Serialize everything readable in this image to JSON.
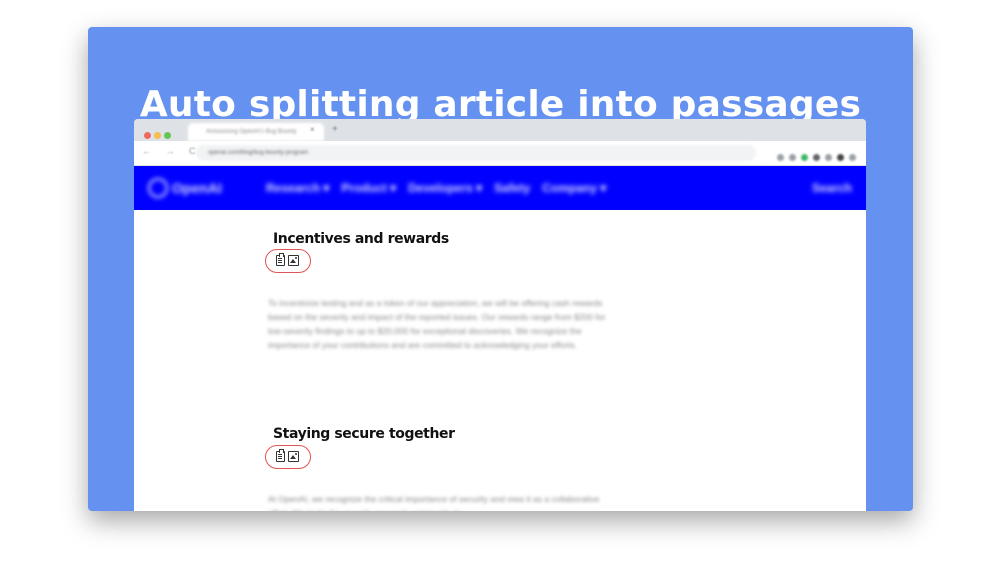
{
  "headline": "Auto splitting article into passages",
  "browser": {
    "tab_title": "Announcing OpenAI's Bug Bounty",
    "tab_close": "×",
    "tab_new": "+",
    "nav_arrows": "← → C",
    "url": "openai.com/blog/bug-bounty-program"
  },
  "site": {
    "logo": "OpenAI",
    "nav_items": [
      "Research ▾",
      "Product ▾",
      "Developers ▾",
      "Safety",
      "Company ▾"
    ],
    "search": "Search"
  },
  "sections": [
    {
      "heading": "Incentives and rewards",
      "copy_icon": "clipboard-icon",
      "image_icon": "image-icon",
      "text": "To incentivize testing and as a token of our appreciation, we will be offering cash rewards based on the severity and impact of the reported issues. Our rewards range from $200 for low-severity findings to up to $20,000 for exceptional discoveries. We recognize the importance of your contributions and are committed to acknowledging your efforts."
    },
    {
      "heading": "Staying secure together",
      "copy_icon": "clipboard-icon",
      "image_icon": "image-icon",
      "text": "At OpenAI, we recognize the critical importance of security and view it as a collaborative effort. We invite the security research community to"
    }
  ],
  "colors": {
    "card_bg": "#6591f0",
    "nav_bg": "#0000ff",
    "pill_border": "#e05555"
  }
}
